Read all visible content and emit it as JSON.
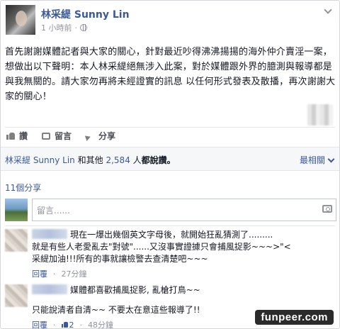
{
  "post": {
    "author": "林采緹 Sunny Lin",
    "time": "1 小時前",
    "text": "首先謝謝媒體記者與大家的關心，針對最近吵得沸沸揚揚的海外仲介賣淫一案，想做出以下聲明：本人林采緹絕無涉入此案，對於媒體跟外界的臆測與報導都是與我無關的。請大家勿再將未經證實的訊息 以任何形式發表及散播，再次謝謝大家的關心！"
  },
  "actions": {
    "like": "讚",
    "comment": "留言",
    "share": "分享"
  },
  "likes": {
    "name": "林采緹 Sunny Lin",
    "middle": "和其他",
    "count": "2,584",
    "suffix": "人",
    "end": "都說讚。",
    "sort": "最相關"
  },
  "shares": "11個分享",
  "composer": {
    "placeholder": "留言......"
  },
  "comments": [
    {
      "line1": "現在一爆出幾個英文字母後，就開始狂亂猜測了.........",
      "line2": "就是有些人老愛亂去\"對號\"......又沒事實證據只會捕風捉影~~~>\"<",
      "line3": "采緹加油!!!所有的事就讓檢警去查清楚吧~~~",
      "reply": "回覆",
      "dot": "·",
      "time": "27分鐘"
    },
    {
      "line1": "媒體都喜歡捕風捉影, 亂槍打鳥~~",
      "line2": "只能說清者自清~~ 不要太在意這些報導了!!",
      "reply": "回覆",
      "dot": "·",
      "likes": "2",
      "time": "48分鐘"
    }
  ],
  "watermark": "funpeer.com"
}
